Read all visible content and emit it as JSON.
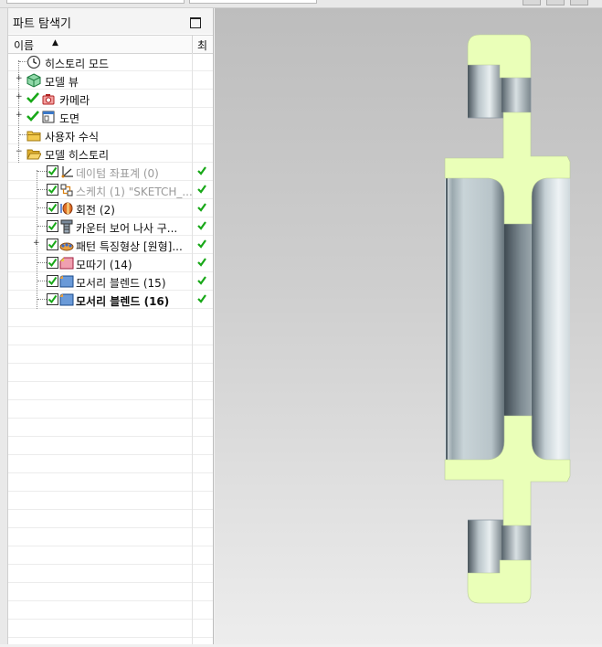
{
  "panel": {
    "title": "파트 탐색기",
    "col_name": "이름",
    "col_other": "최"
  },
  "tree": {
    "history_mode": "히스토리 모드",
    "model_view": "모델 뷰",
    "camera": "카메라",
    "drawing": "도면",
    "user_expressions": "사용자 수식",
    "model_history": "모델 히스토리",
    "features": [
      {
        "label": "데이텀 좌표계 (0)"
      },
      {
        "label": "스케치 (1) \"SKETCH_..."
      },
      {
        "label": "회전 (2)"
      },
      {
        "label": "카운터 보어 나사 구..."
      },
      {
        "label": "패턴 특징형상 [원형]..."
      },
      {
        "label": "모따기 (14)"
      },
      {
        "label": "모서리 블렌드 (15)"
      },
      {
        "label": "모서리 블렌드 (16)"
      }
    ]
  },
  "colors": {
    "section_fill": "#eaffb8",
    "metal_light": "#dfe6e9",
    "metal_dark": "#55626a",
    "check_green": "#18a818"
  }
}
